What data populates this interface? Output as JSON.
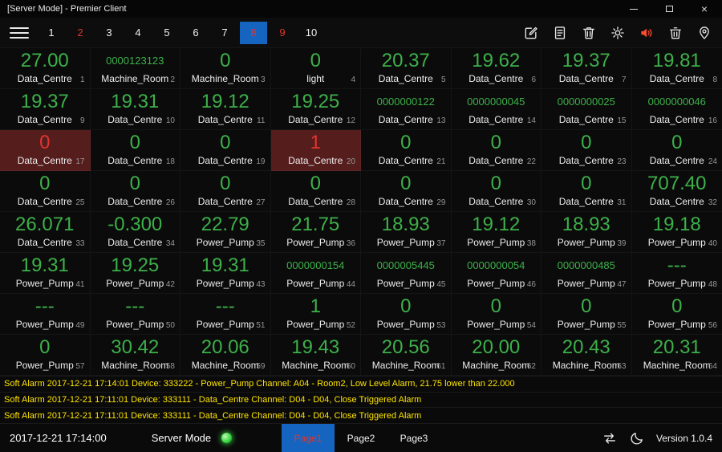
{
  "window": {
    "title": "[Server Mode] - Premier Client",
    "controls": [
      "minimize-icon",
      "maximize-icon",
      "close-icon"
    ],
    "close_glyph": "×"
  },
  "toolbar": {
    "menu_icon": "menu-icon",
    "tabs": [
      {
        "label": "1",
        "state": "normal"
      },
      {
        "label": "2",
        "state": "alert"
      },
      {
        "label": "3",
        "state": "normal"
      },
      {
        "label": "4",
        "state": "normal"
      },
      {
        "label": "5",
        "state": "normal"
      },
      {
        "label": "6",
        "state": "normal"
      },
      {
        "label": "7",
        "state": "normal"
      },
      {
        "label": "8",
        "state": "selected"
      },
      {
        "label": "9",
        "state": "alert"
      },
      {
        "label": "10",
        "state": "normal"
      }
    ],
    "icons": [
      "edit-icon",
      "document-icon",
      "trash-icon",
      "settings-icon",
      "speaker-icon",
      "clear-alarm-icon",
      "location-icon"
    ]
  },
  "grid": {
    "cells": [
      {
        "value": "27.00",
        "label": "Data_Centre",
        "index": 1,
        "state": "normal"
      },
      {
        "value": "0000123123",
        "label": "Machine_Room",
        "index": 2,
        "state": "raw"
      },
      {
        "value": "0",
        "label": "Machine_Room",
        "index": 3,
        "state": "normal"
      },
      {
        "value": "0",
        "label": "light",
        "index": 4,
        "state": "normal"
      },
      {
        "value": "20.37",
        "label": "Data_Centre",
        "index": 5,
        "state": "normal"
      },
      {
        "value": "19.62",
        "label": "Data_Centre",
        "index": 6,
        "state": "normal"
      },
      {
        "value": "19.37",
        "label": "Data_Centre",
        "index": 7,
        "state": "normal"
      },
      {
        "value": "19.81",
        "label": "Data_Centre",
        "index": 8,
        "state": "normal"
      },
      {
        "value": "19.37",
        "label": "Data_Centre",
        "index": 9,
        "state": "normal"
      },
      {
        "value": "19.31",
        "label": "Data_Centre",
        "index": 10,
        "state": "normal"
      },
      {
        "value": "19.12",
        "label": "Data_Centre",
        "index": 11,
        "state": "normal"
      },
      {
        "value": "19.25",
        "label": "Data_Centre",
        "index": 12,
        "state": "normal"
      },
      {
        "value": "0000000122",
        "label": "Data_Centre",
        "index": 13,
        "state": "raw"
      },
      {
        "value": "0000000045",
        "label": "Data_Centre",
        "index": 14,
        "state": "raw"
      },
      {
        "value": "0000000025",
        "label": "Data_Centre",
        "index": 15,
        "state": "raw"
      },
      {
        "value": "0000000046",
        "label": "Data_Centre",
        "index": 16,
        "state": "raw"
      },
      {
        "value": "0",
        "label": "Data_Centre",
        "index": 17,
        "state": "alarm"
      },
      {
        "value": "0",
        "label": "Data_Centre",
        "index": 18,
        "state": "normal"
      },
      {
        "value": "0",
        "label": "Data_Centre",
        "index": 19,
        "state": "normal"
      },
      {
        "value": "1",
        "label": "Data_Centre",
        "index": 20,
        "state": "alarm"
      },
      {
        "value": "0",
        "label": "Data_Centre",
        "index": 21,
        "state": "normal"
      },
      {
        "value": "0",
        "label": "Data_Centre",
        "index": 22,
        "state": "normal"
      },
      {
        "value": "0",
        "label": "Data_Centre",
        "index": 23,
        "state": "normal"
      },
      {
        "value": "0",
        "label": "Data_Centre",
        "index": 24,
        "state": "normal"
      },
      {
        "value": "0",
        "label": "Data_Centre",
        "index": 25,
        "state": "normal"
      },
      {
        "value": "0",
        "label": "Data_Centre",
        "index": 26,
        "state": "normal"
      },
      {
        "value": "0",
        "label": "Data_Centre",
        "index": 27,
        "state": "normal"
      },
      {
        "value": "0",
        "label": "Data_Centre",
        "index": 28,
        "state": "normal"
      },
      {
        "value": "0",
        "label": "Data_Centre",
        "index": 29,
        "state": "normal"
      },
      {
        "value": "0",
        "label": "Data_Centre",
        "index": 30,
        "state": "normal"
      },
      {
        "value": "0",
        "label": "Data_Centre",
        "index": 31,
        "state": "normal"
      },
      {
        "value": "707.40",
        "label": "Data_Centre",
        "index": 32,
        "state": "normal"
      },
      {
        "value": "26.071",
        "label": "Data_Centre",
        "index": 33,
        "state": "normal"
      },
      {
        "value": "-0.300",
        "label": "Data_Centre",
        "index": 34,
        "state": "normal"
      },
      {
        "value": "22.79",
        "label": "Power_Pump",
        "index": 35,
        "state": "normal"
      },
      {
        "value": "21.75",
        "label": "Power_Pump",
        "index": 36,
        "state": "normal"
      },
      {
        "value": "18.93",
        "label": "Power_Pump",
        "index": 37,
        "state": "normal"
      },
      {
        "value": "19.12",
        "label": "Power_Pump",
        "index": 38,
        "state": "normal"
      },
      {
        "value": "18.93",
        "label": "Power_Pump",
        "index": 39,
        "state": "normal"
      },
      {
        "value": "19.18",
        "label": "Power_Pump",
        "index": 40,
        "state": "normal"
      },
      {
        "value": "19.31",
        "label": "Power_Pump",
        "index": 41,
        "state": "normal"
      },
      {
        "value": "19.25",
        "label": "Power_Pump",
        "index": 42,
        "state": "normal"
      },
      {
        "value": "19.31",
        "label": "Power_Pump",
        "index": 43,
        "state": "normal"
      },
      {
        "value": "0000000154",
        "label": "Power_Pump",
        "index": 44,
        "state": "raw"
      },
      {
        "value": "0000005445",
        "label": "Power_Pump",
        "index": 45,
        "state": "raw"
      },
      {
        "value": "0000000054",
        "label": "Power_Pump",
        "index": 46,
        "state": "raw"
      },
      {
        "value": "0000000485",
        "label": "Power_Pump",
        "index": 47,
        "state": "raw"
      },
      {
        "value": "---",
        "label": "Power_Pump",
        "index": 48,
        "state": "normal"
      },
      {
        "value": "---",
        "label": "Power_Pump",
        "index": 49,
        "state": "normal"
      },
      {
        "value": "---",
        "label": "Power_Pump",
        "index": 50,
        "state": "normal"
      },
      {
        "value": "---",
        "label": "Power_Pump",
        "index": 51,
        "state": "normal"
      },
      {
        "value": "1",
        "label": "Power_Pump",
        "index": 52,
        "state": "normal"
      },
      {
        "value": "0",
        "label": "Power_Pump",
        "index": 53,
        "state": "normal"
      },
      {
        "value": "0",
        "label": "Power_Pump",
        "index": 54,
        "state": "normal"
      },
      {
        "value": "0",
        "label": "Power_Pump",
        "index": 55,
        "state": "normal"
      },
      {
        "value": "0",
        "label": "Power_Pump",
        "index": 56,
        "state": "normal"
      },
      {
        "value": "0",
        "label": "Power_Pump",
        "index": 57,
        "state": "normal"
      },
      {
        "value": "30.42",
        "label": "Machine_Room",
        "index": 58,
        "state": "normal"
      },
      {
        "value": "20.06",
        "label": "Machine_Room",
        "index": 59,
        "state": "normal"
      },
      {
        "value": "19.43",
        "label": "Machine_Room",
        "index": 60,
        "state": "normal"
      },
      {
        "value": "20.56",
        "label": "Machine_Room",
        "index": 61,
        "state": "normal"
      },
      {
        "value": "20.00",
        "label": "Machine_Room",
        "index": 62,
        "state": "normal"
      },
      {
        "value": "20.43",
        "label": "Machine_Room",
        "index": 63,
        "state": "normal"
      },
      {
        "value": "20.31",
        "label": "Machine_Room",
        "index": 64,
        "state": "normal"
      }
    ]
  },
  "alarms": {
    "messages": [
      "Soft Alarm 2017-12-21 17:14:01 Device: 333222 - Power_Pump Channel: A04 - Room2, Low Level Alarm, 21.75 lower than 22.000",
      "Soft Alarm 2017-12-21 17:11:01 Device: 333111 - Data_Centre Channel: D04 - D04, Close Triggered Alarm",
      "Soft Alarm 2017-12-21 17:11:01 Device: 333111 - Data_Centre Channel: D04 - D04, Close Triggered Alarm"
    ]
  },
  "statusbar": {
    "datetime": "2017-12-21 17:14:00",
    "mode_label": "Server Mode",
    "status_indicator": "online-green",
    "pages": [
      {
        "label": "Page1",
        "active": true
      },
      {
        "label": "Page2",
        "active": false
      },
      {
        "label": "Page3",
        "active": false
      }
    ],
    "icons": [
      "sync-icon",
      "moon-icon"
    ],
    "version": "Version 1.0.4"
  },
  "colors": {
    "value_green": "#3db04a",
    "alarm_red": "#e0352f",
    "alarm_bg": "#561d1d",
    "warning_yellow": "#ffe400",
    "accent_blue": "#1565c0",
    "speaker_red": "#ff4b2e",
    "status_green": "#35d23c"
  }
}
